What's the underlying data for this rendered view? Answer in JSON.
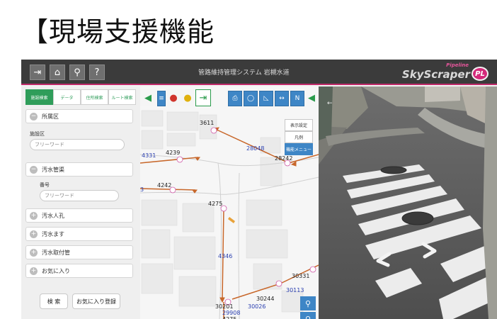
{
  "slide": {
    "title": "【現場支援機能"
  },
  "topbar": {
    "title": "管路維持管理システム 岩槻水道",
    "buttons": [
      {
        "icon": "exit-icon",
        "glyph": "⇥"
      },
      {
        "icon": "home-icon",
        "glyph": "⌂"
      },
      {
        "icon": "zoom-search-icon",
        "glyph": "⚲"
      },
      {
        "icon": "help-icon",
        "glyph": "?"
      }
    ],
    "logo_small": "Pipeline",
    "logo_big": "SkyScraper",
    "logo_badge": "PL",
    "accent_color": "#c02a6a"
  },
  "panel": {
    "tabs": [
      "施設検索",
      "データ",
      "住所検索",
      "ルート検索"
    ],
    "active_tab": 0,
    "group_facility": "所属区",
    "field1_label": "施設区",
    "field1_placeholder": "フリーワード",
    "group_water": "汚水管渠",
    "field2_label": "番号",
    "field2_placeholder": "フリーワード",
    "groups": [
      "汚水人孔",
      "汚水ます",
      "汚水取付管",
      "お気に入り"
    ],
    "search_button": "検 索",
    "favorite_button": "お気に入り登録",
    "accent_color": "#2f9d5a"
  },
  "map": {
    "tools_left": [
      "layer-icon",
      "pin-red-icon",
      "pin-yellow-icon",
      "exit-green-icon"
    ],
    "tools_right": [
      "print-icon",
      "circle-icon",
      "measure-icon",
      "distance-icon",
      "north-icon"
    ],
    "north_label": "N",
    "side_menus": [
      "表示設定",
      "凡例",
      "機能メニュー"
    ],
    "labels": {
      "l3611": "3611",
      "l4331": "4331",
      "l4239": "4239",
      "l28048": "28048",
      "l28242": "28242",
      "l4242": "4242",
      "l3": "3",
      "l4275": "4275",
      "l4346": "4346",
      "l30331": "30331",
      "l30113": "30113",
      "l30244": "30244",
      "l30201": "30201",
      "l30026": "30026",
      "l29908": "29908",
      "l4275b": "4275"
    },
    "pipe_color": "#c8672a"
  }
}
